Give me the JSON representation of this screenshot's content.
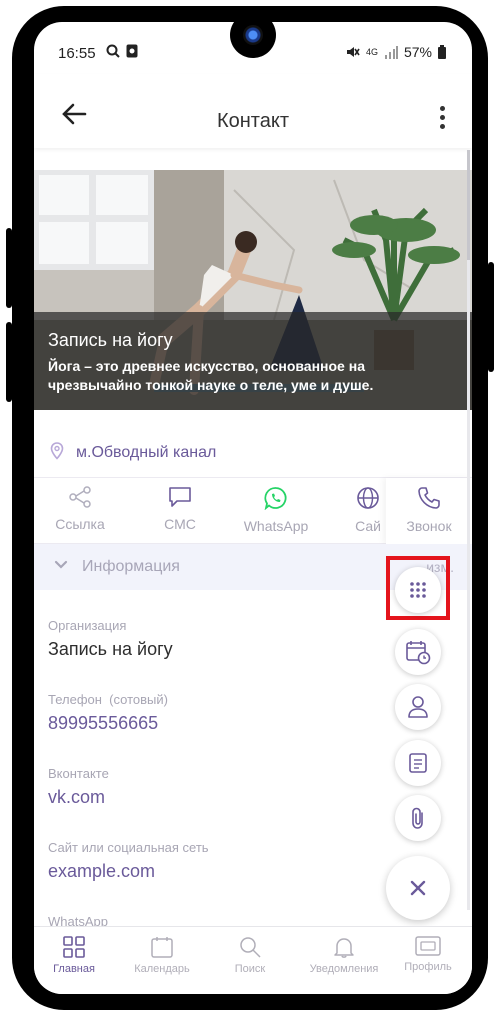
{
  "status_bar": {
    "time": "16:55",
    "network": "4G",
    "battery": "57%",
    "icons": [
      "search-icon",
      "photo-icon",
      "mute-icon",
      "signal-icon",
      "battery-icon"
    ]
  },
  "header": {
    "title": "Контакт",
    "back_icon": "arrow-left-icon",
    "menu_icon": "more-vertical-icon"
  },
  "hero": {
    "title": "Запись на йогу",
    "description_line1": "Йога – это древнее искусство, основанное на",
    "description_line2": "чрезвычайно тонкой науке о теле, уме и душе."
  },
  "address": {
    "icon": "location-pin-icon",
    "text": "м.Обводный канал"
  },
  "actions": [
    {
      "label": "Ссылка",
      "icon": "share-icon"
    },
    {
      "label": "СМС",
      "icon": "sms-icon"
    },
    {
      "label": "WhatsApp",
      "icon": "whatsapp-icon"
    },
    {
      "label": "Сай",
      "icon": "globe-icon"
    },
    {
      "label": "Звонок",
      "icon": "phone-icon"
    }
  ],
  "info": {
    "title": "Информация",
    "edit_label": "изм."
  },
  "fields": [
    {
      "label": "Организация",
      "value": "Запись на йогу"
    },
    {
      "label": "Телефон  (сотовый)",
      "value": "89995556665"
    },
    {
      "label": "Вконтакте",
      "value": "vk.com"
    },
    {
      "label": "Сайт или социальная сеть",
      "value": "example.com"
    },
    {
      "label": "WhatsApp",
      "value": ""
    }
  ],
  "fab_menu": [
    "apps-grid-icon",
    "calendar-clock-icon",
    "person-icon",
    "note-icon",
    "paperclip-icon",
    "close-icon"
  ],
  "bottom_nav": [
    {
      "label": "Главная",
      "icon": "home-grid-icon",
      "active": true
    },
    {
      "label": "Календарь",
      "icon": "calendar-icon",
      "active": false
    },
    {
      "label": "Поиск",
      "icon": "search-icon",
      "active": false
    },
    {
      "label": "Уведомления",
      "icon": "bell-icon",
      "active": false
    },
    {
      "label": "Профиль",
      "icon": "id-card-icon",
      "active": false
    }
  ],
  "colors": {
    "accent": "#6a5a9a",
    "whatsapp": "#25d366",
    "highlight": "#e4141c",
    "label_gray": "#a8a6b4"
  }
}
